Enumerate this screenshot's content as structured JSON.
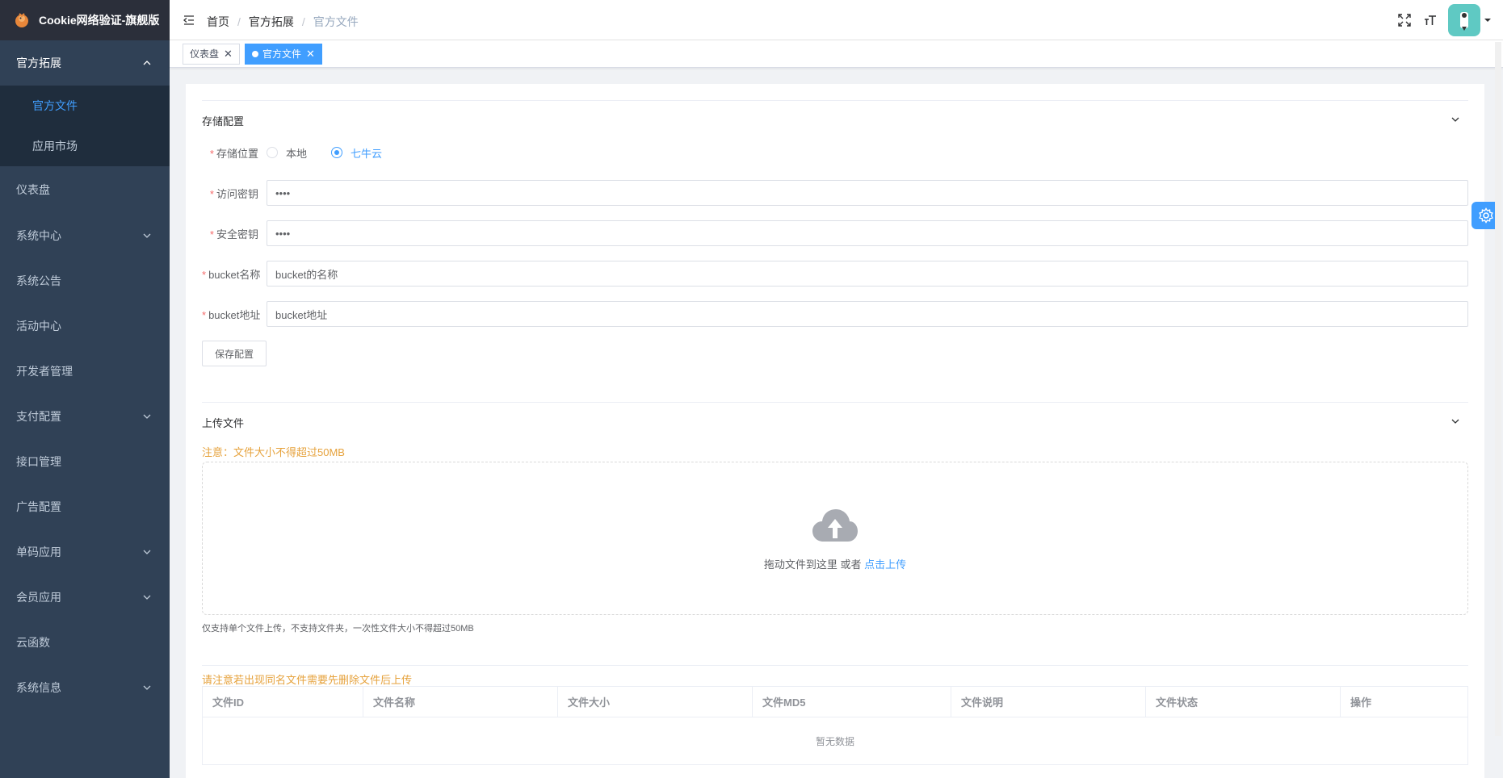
{
  "app": {
    "title": "Cookie网络验证-旗舰版"
  },
  "sidebar": {
    "expanded": {
      "label": "官方拓展",
      "children": [
        {
          "label": "官方文件",
          "active": true
        },
        {
          "label": "应用市场"
        }
      ]
    },
    "items": [
      {
        "label": "仪表盘",
        "has_children": false
      },
      {
        "label": "系统中心",
        "has_children": true
      },
      {
        "label": "系统公告",
        "has_children": false
      },
      {
        "label": "活动中心",
        "has_children": false
      },
      {
        "label": "开发者管理",
        "has_children": false
      },
      {
        "label": "支付配置",
        "has_children": true
      },
      {
        "label": "接口管理",
        "has_children": false
      },
      {
        "label": "广告配置",
        "has_children": false
      },
      {
        "label": "单码应用",
        "has_children": true
      },
      {
        "label": "会员应用",
        "has_children": true
      },
      {
        "label": "云函数",
        "has_children": false
      },
      {
        "label": "系统信息",
        "has_children": true
      }
    ]
  },
  "breadcrumb": [
    "首页",
    "官方拓展",
    "官方文件"
  ],
  "tags": [
    {
      "label": "仪表盘",
      "active": false
    },
    {
      "label": "官方文件",
      "active": true
    }
  ],
  "storage": {
    "title": "存储配置",
    "location_label": "存储位置",
    "options": [
      {
        "label": "本地",
        "checked": false
      },
      {
        "label": "七牛云",
        "checked": true
      }
    ],
    "access_key_label": "访问密钥",
    "access_key_value": "••••",
    "secret_key_label": "安全密钥",
    "secret_key_value": "••••",
    "bucket_name_label": "bucket名称",
    "bucket_name_value": "bucket的名称",
    "bucket_url_label": "bucket地址",
    "bucket_url_value": "bucket地址",
    "save_label": "保存配置"
  },
  "upload": {
    "title": "上传文件",
    "notice": "注意：文件大小不得超过50MB",
    "drag_text": "拖动文件到这里 或者",
    "click_text": "点击上传",
    "tip": "仅支持单个文件上传，不支持文件夹，一次性文件大小不得超过50MB"
  },
  "files": {
    "notice": "请注意若出现同名文件需要先删除文件后上传",
    "columns": [
      "文件ID",
      "文件名称",
      "文件大小",
      "文件MD5",
      "文件说明",
      "文件状态",
      "操作"
    ],
    "empty_text": "暂无数据"
  },
  "colors": {
    "sidebar_bg": "#304156",
    "accent": "#409eff",
    "warning": "#e6a23c",
    "required": "#f56c6c"
  }
}
